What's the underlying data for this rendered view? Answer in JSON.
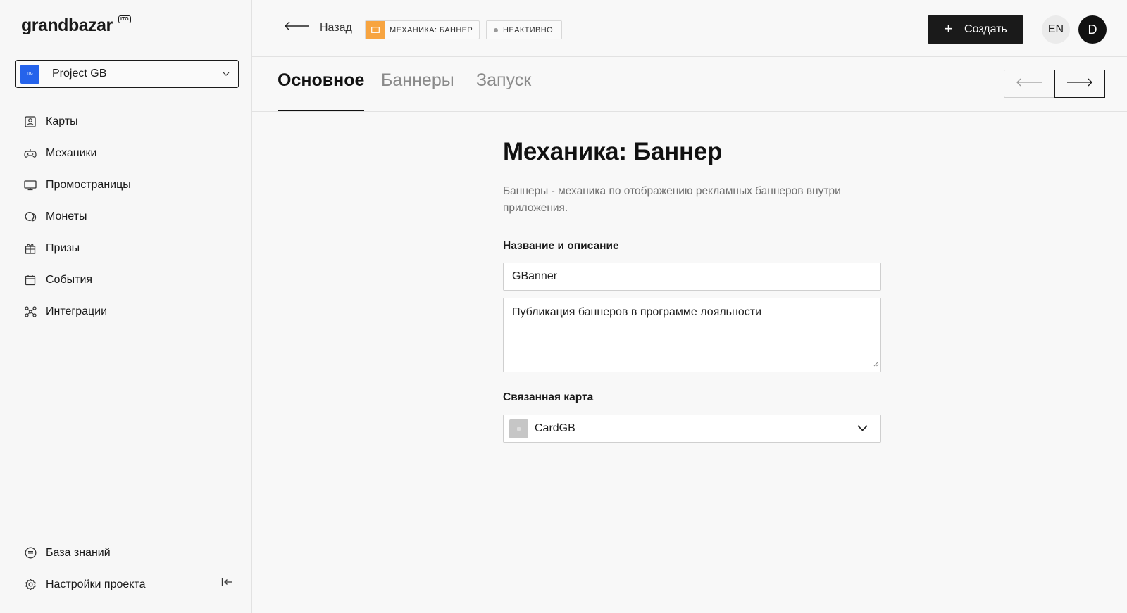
{
  "brand": {
    "logo": "grandbazar",
    "logo_badge": "ITG"
  },
  "project": {
    "avatar_text": "ITG",
    "name": "Project GB"
  },
  "nav": {
    "items": [
      {
        "label": "Карты",
        "icon": "cards-icon"
      },
      {
        "label": "Механики",
        "icon": "gamepad-icon"
      },
      {
        "label": "Промостраницы",
        "icon": "monitor-icon"
      },
      {
        "label": "Монеты",
        "icon": "coins-icon"
      },
      {
        "label": "Призы",
        "icon": "gift-icon"
      },
      {
        "label": "События",
        "icon": "calendar-icon"
      },
      {
        "label": "Интеграции",
        "icon": "integrations-icon"
      }
    ],
    "bottom": [
      {
        "label": "База знаний",
        "icon": "knowledge-icon"
      },
      {
        "label": "Настройки проекта",
        "icon": "settings-icon"
      }
    ]
  },
  "header": {
    "back_label": "Назад",
    "mechanic_tag": "МЕХАНИКА: БАННЕР",
    "status_tag": "НЕАКТИВНО",
    "create_label": "Создать",
    "lang": "EN",
    "user_initial": "D"
  },
  "tabs": [
    {
      "label": "Основное",
      "active": true
    },
    {
      "label": "Баннеры",
      "active": false
    },
    {
      "label": "Запуск",
      "active": false
    }
  ],
  "main": {
    "title": "Механика: Баннер",
    "description": "Баннеры - механика по отображению рекламных баннеров внутри приложения.",
    "name_section_label": "Название и описание",
    "name_value": "GBanner",
    "description_value": "Публикация баннеров в программе лояльности",
    "card_section_label": "Связанная карта",
    "card_value": "CardGB"
  },
  "colors": {
    "accent_orange": "#f7a440",
    "project_blue": "#2563eb",
    "dark": "#1a1a1a"
  }
}
